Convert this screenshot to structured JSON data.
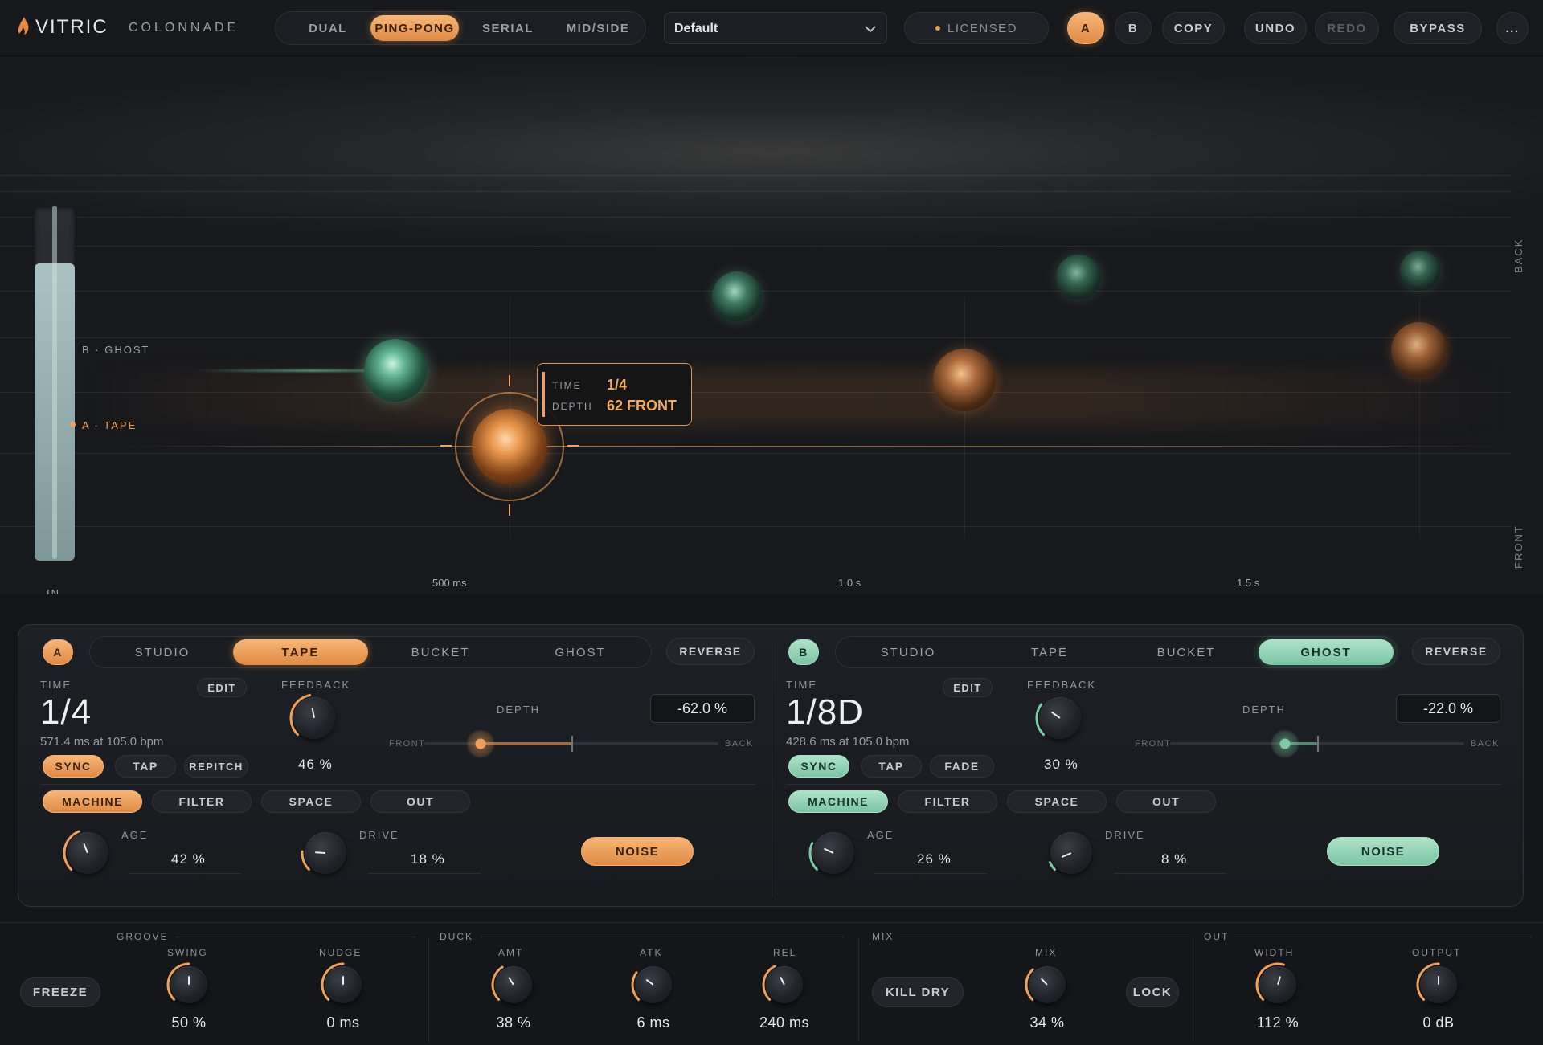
{
  "brand": {
    "logo": "VITRIC",
    "product": "COLONNADE",
    "logo_icon": "flame-icon"
  },
  "modes": {
    "items": [
      "DUAL",
      "PING-PONG",
      "SERIAL",
      "MID/SIDE"
    ],
    "active": "PING-PONG"
  },
  "preset": {
    "value": "Default",
    "icon": "chevron-down-icon"
  },
  "license": {
    "label": "LICENSED"
  },
  "toolbar": {
    "a": "A",
    "b": "B",
    "copy": "COPY",
    "undo": "UNDO",
    "redo": "REDO",
    "bypass": "BYPASS",
    "more": "..."
  },
  "viz": {
    "side_back": "BACK",
    "side_front": "FRONT",
    "in_label": "IN",
    "lane_b": "B  ·  GHOST",
    "lane_a": "A  ·  TAPE",
    "ticks": [
      "500 ms",
      "1.0 s",
      "1.5 s"
    ],
    "tooltip": {
      "time_label": "TIME",
      "time_value": "1/4",
      "depth_label": "DEPTH",
      "depth_value": "62 FRONT"
    },
    "input_level": 0.84,
    "accent_a": "#f0a05a",
    "accent_b": "#7cc9a6"
  },
  "panel_a": {
    "badge": "A",
    "tabs": [
      "STUDIO",
      "TAPE",
      "BUCKET",
      "GHOST"
    ],
    "active_tab": "TAPE",
    "reverse": "REVERSE",
    "time_label": "TIME",
    "edit": "EDIT",
    "time_value": "1/4",
    "time_sub": "571.4 ms at 105.0 bpm",
    "sync": "SYNC",
    "tap": "TAP",
    "extra": "REPITCH",
    "feedback_label": "FEEDBACK",
    "feedback_value": "46 %",
    "feedback_level": 0.46,
    "depth_label": "DEPTH",
    "depth_value": "-62.0 %",
    "depth_front": "FRONT",
    "depth_back": "BACK",
    "depth_level": -0.62,
    "subtabs": [
      "MACHINE",
      "FILTER",
      "SPACE",
      "OUT"
    ],
    "active_subtab": "MACHINE",
    "age_label": "AGE",
    "age_value": "42 %",
    "age_level": 0.42,
    "drive_label": "DRIVE",
    "drive_value": "18 %",
    "drive_level": 0.18,
    "noise": "NOISE"
  },
  "panel_b": {
    "badge": "B",
    "tabs": [
      "STUDIO",
      "TAPE",
      "BUCKET",
      "GHOST"
    ],
    "active_tab": "GHOST",
    "reverse": "REVERSE",
    "time_label": "TIME",
    "edit": "EDIT",
    "time_value": "1/8D",
    "time_sub": "428.6 ms at 105.0 bpm",
    "sync": "SYNC",
    "tap": "TAP",
    "extra": "FADE",
    "feedback_label": "FEEDBACK",
    "feedback_value": "30 %",
    "feedback_level": 0.3,
    "depth_label": "DEPTH",
    "depth_value": "-22.0 %",
    "depth_front": "FRONT",
    "depth_back": "BACK",
    "depth_level": -0.22,
    "subtabs": [
      "MACHINE",
      "FILTER",
      "SPACE",
      "OUT"
    ],
    "active_subtab": "MACHINE",
    "age_label": "AGE",
    "age_value": "26 %",
    "age_level": 0.26,
    "drive_label": "DRIVE",
    "drive_value": "8 %",
    "drive_level": 0.08,
    "noise": "NOISE"
  },
  "bottom": {
    "freeze": "FREEZE",
    "groove": {
      "label": "GROOVE",
      "swing_label": "SWING",
      "swing_value": "50 %",
      "swing_level": 0.5,
      "nudge_label": "NUDGE",
      "nudge_value": "0 ms",
      "nudge_level": 0.5
    },
    "duck": {
      "label": "DUCK",
      "amt_label": "AMT",
      "amt_value": "38 %",
      "amt_level": 0.38,
      "atk_label": "ATK",
      "atk_value": "6 ms",
      "atk_level": 0.3,
      "rel_label": "REL",
      "rel_value": "240 ms",
      "rel_level": 0.4
    },
    "mix": {
      "label": "MIX",
      "kill_dry": "KILL DRY",
      "mix_label": "MIX",
      "mix_value": "34 %",
      "mix_level": 0.34,
      "lock": "LOCK"
    },
    "out": {
      "label": "OUT",
      "width_label": "WIDTH",
      "width_value": "112 %",
      "width_level": 0.56,
      "output_label": "OUTPUT",
      "output_value": "0 dB",
      "output_level": 0.5
    }
  }
}
